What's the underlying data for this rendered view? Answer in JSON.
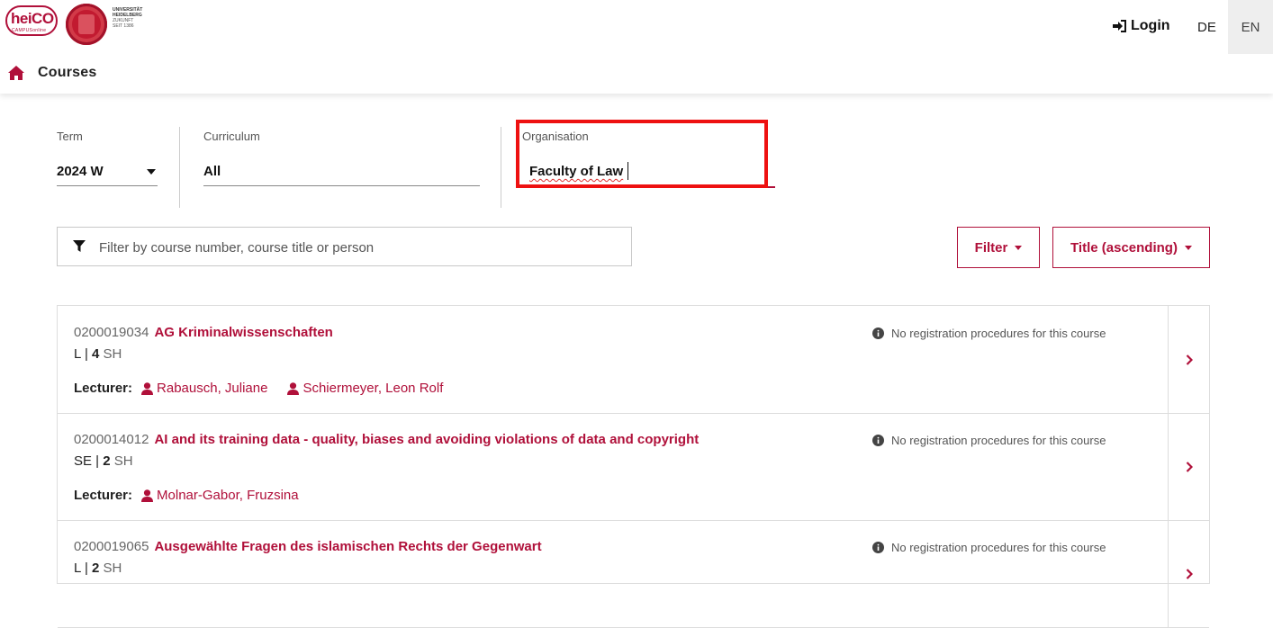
{
  "header": {
    "logo_text": "heiCO",
    "logo_sub": "CAMPUSonline",
    "university_line1": "UNIVERSITÄT",
    "university_line2": "HEIDELBERG",
    "university_line3": "ZUKUNFT",
    "university_line4": "SEIT 1386",
    "login_label": "Login",
    "lang_de": "DE",
    "lang_en": "EN"
  },
  "breadcrumb": {
    "current": "Courses"
  },
  "filters": {
    "term_label": "Term",
    "term_value": "2024 W",
    "curriculum_label": "Curriculum",
    "curriculum_value": "All",
    "organisation_label": "Organisation",
    "organisation_value": "Faculty of Law"
  },
  "search": {
    "placeholder": "Filter by course number, course title or person"
  },
  "toolbar": {
    "filter_label": "Filter",
    "sort_label": "Title (ascending)"
  },
  "courses": [
    {
      "number": "0200019034",
      "title": "AG Kriminalwissenschaften",
      "type": "L",
      "hours": "4",
      "hours_unit": "SH",
      "lecturer_label": "Lecturer:",
      "lecturers": [
        "Rabausch, Juliane",
        "Schiermeyer, Leon Rolf"
      ],
      "registration": "No registration procedures for this course"
    },
    {
      "number": "0200014012",
      "title": "AI and its training data - quality, biases and avoiding violations of data and copyright",
      "type": "SE",
      "hours": "2",
      "hours_unit": "SH",
      "lecturer_label": "Lecturer:",
      "lecturers": [
        "Molnar-Gabor, Fruzsina"
      ],
      "registration": "No registration procedures for this course"
    },
    {
      "number": "0200019065",
      "title": "Ausgewählte Fragen des islamischen Rechts der Gegenwart",
      "type": "L",
      "hours": "2",
      "hours_unit": "SH",
      "registration": "No registration procedures for this course"
    }
  ],
  "colors": {
    "accent": "#b0103a",
    "highlight": "#ee1111"
  }
}
